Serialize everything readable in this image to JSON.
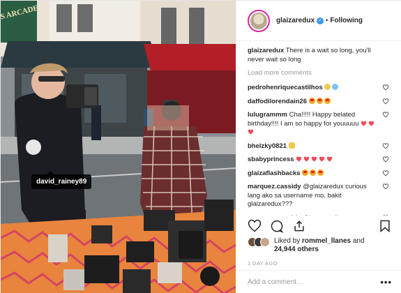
{
  "post": {
    "username": "glaizaredux",
    "verified": true,
    "follow_status": "Following",
    "separator": "•",
    "photo_tag": "david_rainey89",
    "shop_sign_text": "S ARCADE"
  },
  "caption": {
    "username": "glaizaredux",
    "text": "There is a wait so long, you'll never wait so long"
  },
  "load_more_label": "Load more comments",
  "comments": [
    {
      "username": "pedrohenriquecastilhos",
      "text": "",
      "emoji": [
        "sad-face",
        "crying-face"
      ]
    },
    {
      "username": "daffodilorendain26",
      "text": "",
      "emoji": [
        "heart-eyes",
        "heart-eyes",
        "heart-eyes"
      ]
    },
    {
      "username": "lulugrammm",
      "text": "Cha!!!!! Happy belated birthday!!!! I am so happy for youuuuu",
      "emoji": [
        "red-heart",
        "red-heart",
        "red-heart"
      ]
    },
    {
      "username": "bhelzky0821",
      "text": "",
      "emoji": [
        "clapping-hands"
      ]
    },
    {
      "username": "sbabyprincess",
      "text": "",
      "emoji": [
        "hearts",
        "hearts",
        "hearts",
        "red-heart",
        "red-heart"
      ]
    },
    {
      "username": "glaizaflashbacks",
      "text": "",
      "emoji": [
        "heart-eyes",
        "heart-eyes",
        "heart-eyes"
      ]
    },
    {
      "username": "marquez.cassidy",
      "text": "@glaizaredux curious lang ako sa username mo. bakit glaizaredux???",
      "emoji": []
    },
    {
      "username": "marquez.cassidy",
      "text": "@iamangelicap balentayms na naman pero wala kang",
      "emoji": []
    }
  ],
  "actions": {
    "like": "heart-icon",
    "comment": "comment-icon",
    "share": "share-icon",
    "save": "bookmark-icon"
  },
  "likes": {
    "prefix": "Liked by",
    "user": "rommel_llanes",
    "conj": "and",
    "others": "24,944 others"
  },
  "time_ago": "1 DAY AGO",
  "add_comment": {
    "placeholder": "Add a comment…",
    "more": "•••"
  },
  "colors": {
    "link": "#003569",
    "verified": "#3897f0",
    "muted": "#999999",
    "heart_red": "#ed4956"
  }
}
